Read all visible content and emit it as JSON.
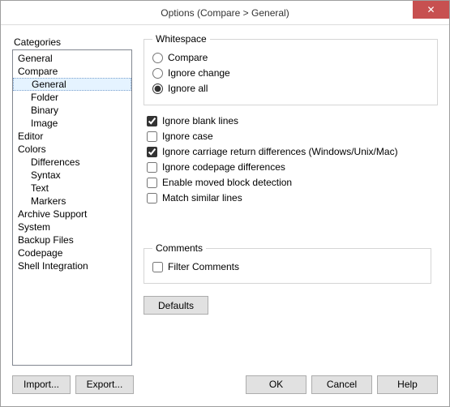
{
  "window": {
    "title": "Options (Compare > General)",
    "close_glyph": "✕"
  },
  "sidebar": {
    "label": "Categories",
    "items": [
      {
        "label": "General",
        "child": false
      },
      {
        "label": "Compare",
        "child": false
      },
      {
        "label": "General",
        "child": true,
        "selected": true
      },
      {
        "label": "Folder",
        "child": true
      },
      {
        "label": "Binary",
        "child": true
      },
      {
        "label": "Image",
        "child": true
      },
      {
        "label": "Editor",
        "child": false
      },
      {
        "label": "Colors",
        "child": false
      },
      {
        "label": "Differences",
        "child": true
      },
      {
        "label": "Syntax",
        "child": true
      },
      {
        "label": "Text",
        "child": true
      },
      {
        "label": "Markers",
        "child": true
      },
      {
        "label": "Archive Support",
        "child": false
      },
      {
        "label": "System",
        "child": false
      },
      {
        "label": "Backup Files",
        "child": false
      },
      {
        "label": "Codepage",
        "child": false
      },
      {
        "label": "Shell Integration",
        "child": false
      }
    ]
  },
  "whitespace": {
    "legend": "Whitespace",
    "options": {
      "compare": "Compare",
      "ignore_change": "Ignore change",
      "ignore_all": "Ignore all"
    },
    "selected": "ignore_all"
  },
  "checks": {
    "ignore_blank_lines": {
      "label": "Ignore blank lines",
      "checked": true
    },
    "ignore_case": {
      "label": "Ignore case",
      "checked": false
    },
    "ignore_cr": {
      "label": "Ignore carriage return differences (Windows/Unix/Mac)",
      "checked": true
    },
    "ignore_codepage": {
      "label": "Ignore codepage differences",
      "checked": false
    },
    "moved_block": {
      "label": "Enable moved block detection",
      "checked": false
    },
    "match_similar": {
      "label": "Match similar lines",
      "checked": false
    }
  },
  "comments": {
    "legend": "Comments",
    "filter": {
      "label": "Filter Comments",
      "checked": false
    }
  },
  "buttons": {
    "defaults": "Defaults",
    "import": "Import...",
    "export": "Export...",
    "ok": "OK",
    "cancel": "Cancel",
    "help": "Help"
  }
}
